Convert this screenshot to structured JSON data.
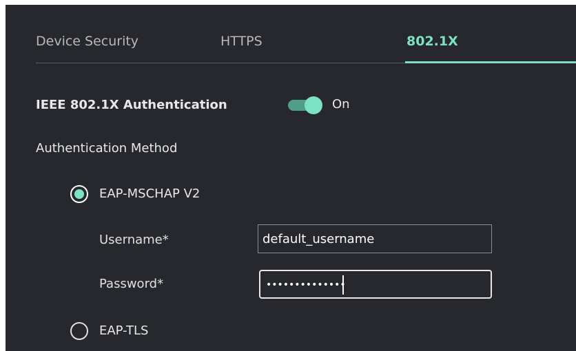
{
  "tabs": [
    {
      "label": "Device Security",
      "active": false
    },
    {
      "label": "HTTPS",
      "active": false
    },
    {
      "label": "802.1X",
      "active": true
    }
  ],
  "ieee": {
    "label": "IEEE 802.1X Authentication",
    "enabled": true,
    "state_label": "On"
  },
  "auth_method": {
    "label": "Authentication Method",
    "options": [
      {
        "label": "EAP-MSCHAP V2",
        "selected": true
      },
      {
        "label": "EAP-TLS",
        "selected": false
      }
    ]
  },
  "username": {
    "label": "Username*",
    "value": "default_username"
  },
  "password": {
    "label": "Password*",
    "masked_value": "••••••••••••••"
  },
  "colors": {
    "background": "#26282d",
    "accent": "#7be3c3",
    "toggle_track": "#4f9f86",
    "text": "#e8e8e8",
    "muted_text": "#b8b8b8"
  },
  "icons": {
    "toggle": "toggle-switch-on",
    "radio_selected": "radio-checked-icon",
    "radio_unselected": "radio-unchecked-icon"
  }
}
